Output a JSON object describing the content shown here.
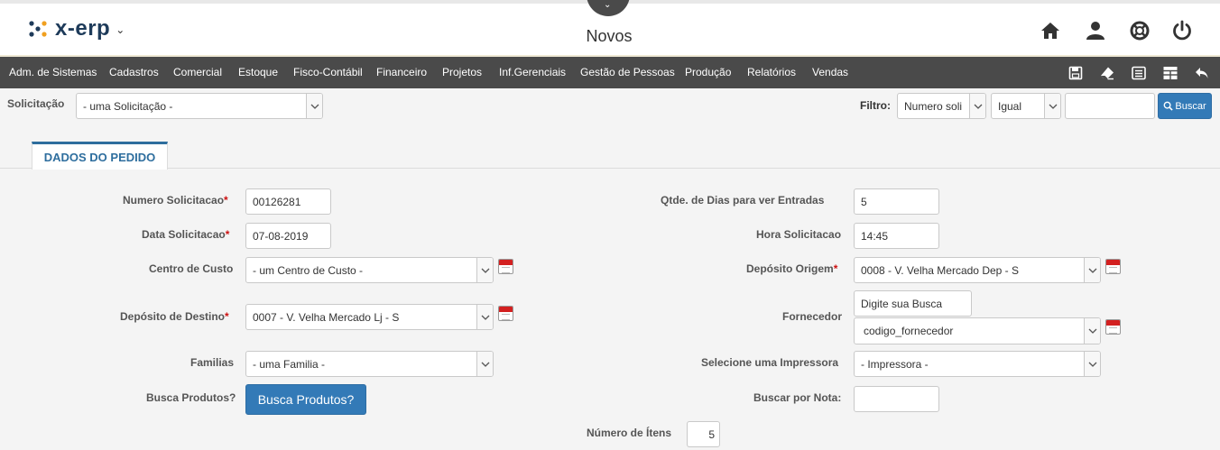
{
  "app": {
    "logo_text": "x-erp",
    "page_title": "Novos"
  },
  "header_icons": [
    "home-icon",
    "user-icon",
    "help-lifebuoy-icon",
    "power-icon"
  ],
  "menu": {
    "items": [
      "Adm. de Sistemas",
      "Cadastros",
      "Comercial",
      "Estoque",
      "Fisco-Contábil",
      "Financeiro",
      "Projetos",
      "Inf.Gerenciais",
      "Gestão de Pessoas",
      "Produção",
      "Relatórios",
      "Vendas"
    ],
    "tool_icons": [
      "save-icon",
      "eraser-icon",
      "list-icon",
      "grid-icon",
      "back-arrow-icon"
    ]
  },
  "toolbar": {
    "solicitacao_label": "Solicitação",
    "solicitacao_value": "- uma Solicitação -",
    "filtro_label": "Filtro:",
    "filtro_field": "Numero soli",
    "filtro_op": "Igual",
    "filtro_value": "",
    "buscar_label": "Buscar"
  },
  "tab": {
    "label": "DADOS DO PEDIDO"
  },
  "form": {
    "numero_solicitacao": {
      "label": "Numero Solicitacao",
      "value": "00126281"
    },
    "data_solicitacao": {
      "label": "Data Solicitacao",
      "value": "07-08-2019"
    },
    "centro_custo": {
      "label": "Centro de Custo",
      "value": "- um Centro de Custo -"
    },
    "deposito_destino": {
      "label": "Depósito de Destino",
      "value": "0007 - V. Velha Mercado Lj - S"
    },
    "familias": {
      "label": "Familias",
      "value": "- uma Familia -"
    },
    "busca_produtos": {
      "label": "Busca Produtos?",
      "button": "Busca Produtos?"
    },
    "qtde_dias": {
      "label": "Qtde. de Dias para ver Entradas",
      "value": "5"
    },
    "hora_solicitacao": {
      "label": "Hora Solicitacao",
      "value": "14:45"
    },
    "deposito_origem": {
      "label": "Depósito Origem",
      "value": "0008 - V. Velha Mercado Dep - S"
    },
    "fornecedor": {
      "label": "Fornecedor",
      "search_value": "Digite sua Busca",
      "select_value": "codigo_fornecedor"
    },
    "impressora": {
      "label": "Selecione uma Impressora",
      "value": "- Impressora -"
    },
    "buscar_nota": {
      "label": "Buscar por Nota:",
      "value": ""
    },
    "numero_itens": {
      "label": "Número de Ítens",
      "value": "5"
    }
  },
  "required_mark": "*"
}
